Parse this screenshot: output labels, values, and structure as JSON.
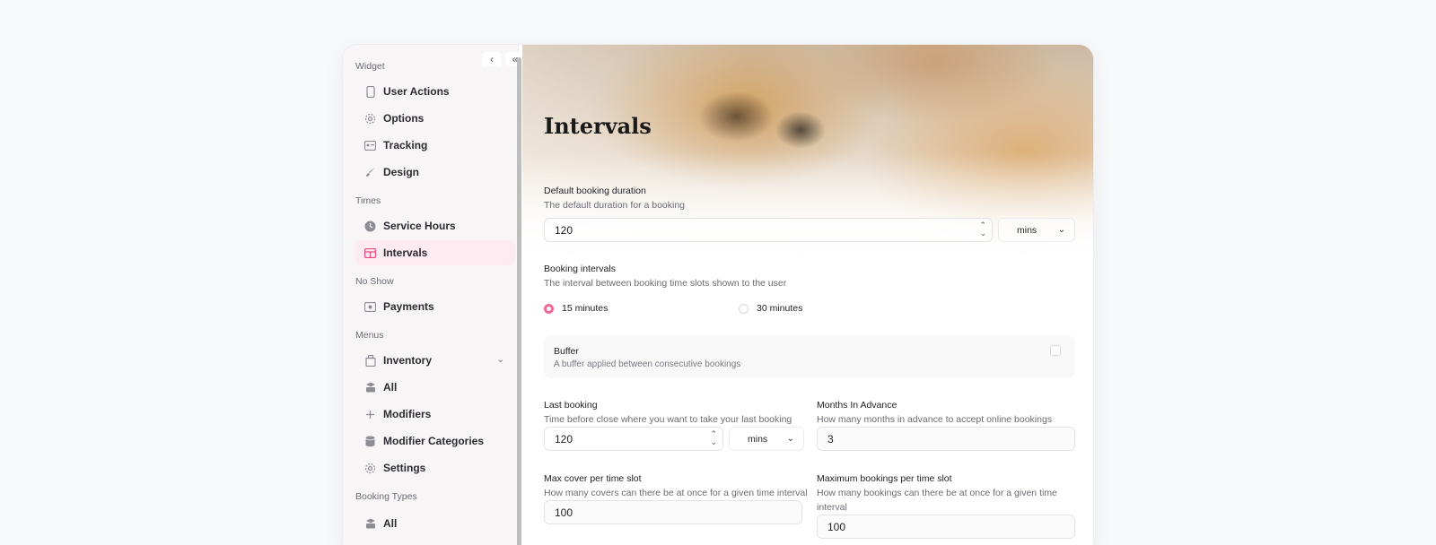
{
  "sidebar": {
    "collapse_labels": [
      "‹",
      "«"
    ],
    "sections": {
      "widget": "Widget",
      "times": "Times",
      "no_show": "No Show",
      "menus": "Menus",
      "booking_types": "Booking Types"
    },
    "items": [
      {
        "label": "User Actions",
        "icon": "phone-icon"
      },
      {
        "label": "Options",
        "icon": "gear-icon"
      },
      {
        "label": "Tracking",
        "icon": "id-card-icon"
      },
      {
        "label": "Design",
        "icon": "brush-icon"
      },
      {
        "label": "Service Hours",
        "icon": "clock-icon"
      },
      {
        "label": "Intervals",
        "icon": "table-icon",
        "active": true
      },
      {
        "label": "Payments",
        "icon": "payment-icon"
      },
      {
        "label": "Inventory",
        "icon": "package-icon"
      },
      {
        "label": "All",
        "icon": "stack-icon"
      },
      {
        "label": "Modifiers",
        "icon": "plus-icon"
      },
      {
        "label": "Modifier Categories",
        "icon": "database-icon"
      },
      {
        "label": "Settings",
        "icon": "gear-icon"
      },
      {
        "label": "All",
        "icon": "stack-icon"
      }
    ]
  },
  "main": {
    "title": "Intervals",
    "default_duration": {
      "label": "Default booking duration",
      "description": "The default duration for a booking",
      "value": "120",
      "unit": "mins"
    },
    "booking_intervals": {
      "label": "Booking intervals",
      "description": "The interval between booking time slots shown to the user",
      "options": [
        "15 minutes",
        "30 minutes"
      ],
      "selected": "15 minutes"
    },
    "buffer": {
      "label": "Buffer",
      "description": "A buffer applied between consecutive bookings"
    },
    "last_booking": {
      "label": "Last booking",
      "description": "Time before close where you want to take your last booking",
      "value": "120",
      "unit": "mins"
    },
    "months_in_advance": {
      "label": "Months In Advance",
      "description": "How many months in advance to accept online bookings",
      "value": "3"
    },
    "max_cover": {
      "label": "Max cover per time slot",
      "description": "How many covers can there be at once for a given time interval",
      "value": "100"
    },
    "max_bookings": {
      "label": "Maximum bookings per time slot",
      "description_line1": "How many bookings can there be at once for a given time",
      "description_line2": "interval",
      "value": "100"
    }
  },
  "colors": {
    "accent": "#e8457a",
    "active_bg": "#fdebf1"
  }
}
